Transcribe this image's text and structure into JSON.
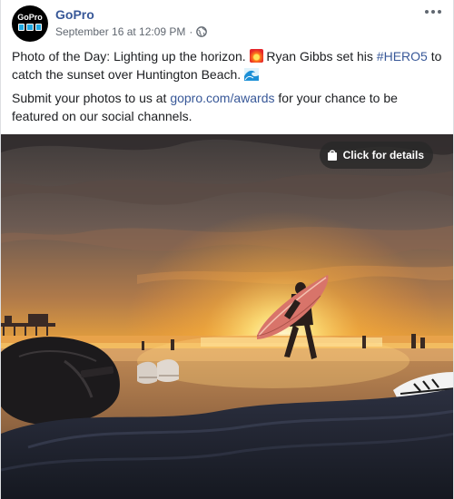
{
  "post": {
    "page_name": "GoPro",
    "avatar_logo_text": "GoPro",
    "timestamp": "September 16 at 12:09 PM",
    "separator": "·",
    "paragraph1": {
      "part1": "Photo of the Day: Lighting up the horizon.",
      "part2": "Ryan Gibbs set his",
      "hashtag": "#HERO5",
      "part3": "to catch the sunset over Huntington Beach."
    },
    "paragraph2": {
      "part1": "Submit your photos to us at",
      "link": "gopro.com/awards",
      "part2": "for your chance to be featured on our social channels."
    },
    "details_button_label": "Click for details"
  },
  "colors": {
    "link": "#385898",
    "meta": "#606770",
    "text": "#1c1e21"
  },
  "icons": {
    "more": "more-horizontal-icon",
    "audience": "globe-icon",
    "details": "shopping-bag-icon",
    "emoji1": "sunset-emoji",
    "emoji2": "wave-emoji"
  }
}
